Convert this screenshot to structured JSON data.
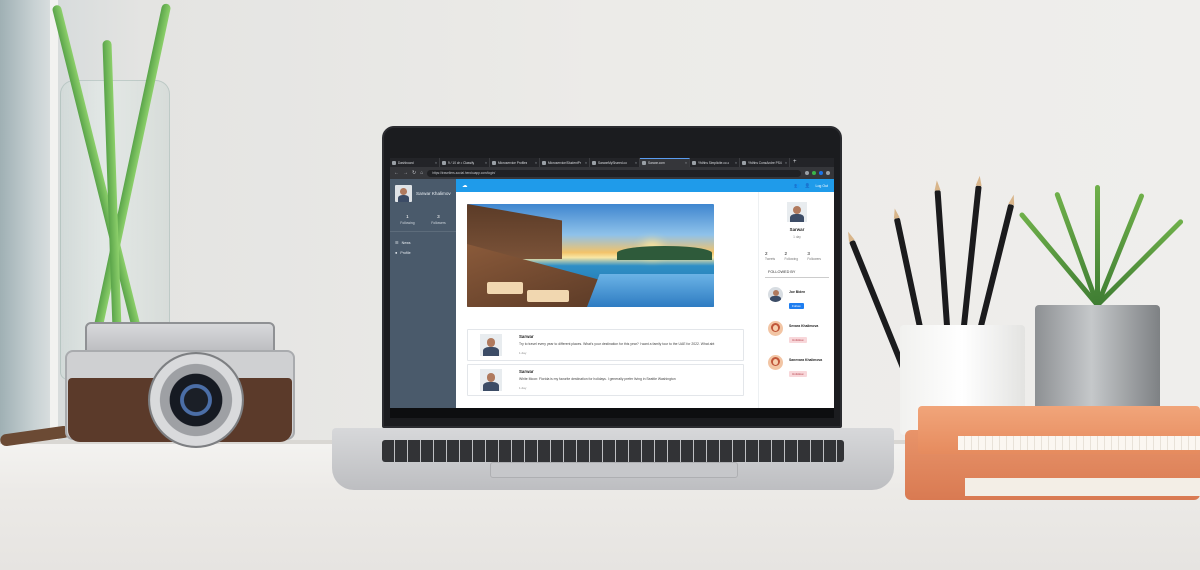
{
  "browser": {
    "tabs": [
      {
        "label": "Dashboard",
        "active": false
      },
      {
        "label": "9 / 10 ch • Classify",
        "active": false
      },
      {
        "label": "Microservice Profiles",
        "active": false
      },
      {
        "label": "Microservice/StudentPr",
        "active": false
      },
      {
        "label": "SarwarMyShared.co",
        "active": false
      },
      {
        "label": "Sarwar.com",
        "active": true
      },
      {
        "label": "Yfdhhs Simplicite.co.c",
        "active": false
      },
      {
        "label": "Yfdhhs ConsAndre PS4",
        "active": false
      }
    ],
    "new_tab_label": "+",
    "url": "https://travellers-social.herokuapp.com/login/"
  },
  "sidebar": {
    "user_name": "Sarwar Khalimov",
    "stats": [
      {
        "value": "1",
        "label": "Following"
      },
      {
        "value": "3",
        "label": "Followers"
      }
    ],
    "menu": [
      {
        "icon": "news-icon",
        "label": "News"
      },
      {
        "icon": "profile-icon",
        "label": "Profile"
      }
    ]
  },
  "topnav": {
    "logout_label": "Log Out"
  },
  "feed": {
    "posts": [
      {
        "author": "Sarwar",
        "text": "Try to travel every year to different places. What's your destination for this year? I want a family tour to the UAE for 2022. What abt",
        "time": "1 day"
      },
      {
        "author": "Sarwar",
        "text": "White Moon: Florida is my favorite destination for holidays. I generally prefer living in Seattle Washington",
        "time": "1 day"
      }
    ]
  },
  "profile_card": {
    "name": "Sarwar",
    "subtitle": "1 day",
    "stats": [
      {
        "value": "2",
        "label": "Tweets"
      },
      {
        "value": "2",
        "label": "Following"
      },
      {
        "value": "3",
        "label": "Followers"
      }
    ],
    "followed_by_heading": "FOLLOWED BY",
    "followed_by": [
      {
        "name": "Joe Biden",
        "button": "Follow",
        "type": "follow",
        "avatar": "male"
      },
      {
        "name": "Sevara Khalimova",
        "button": "Unfollow",
        "type": "unfollow",
        "avatar": "female"
      },
      {
        "name": "Sanevara Khalimova",
        "button": "Unfollow",
        "type": "unfollow",
        "avatar": "female"
      }
    ]
  },
  "colors": {
    "topnav": "#1f9bea",
    "sidebar": "#4a5a6b",
    "follow_button": "#1f7ef0",
    "unfollow_button": "#f8d7da"
  }
}
